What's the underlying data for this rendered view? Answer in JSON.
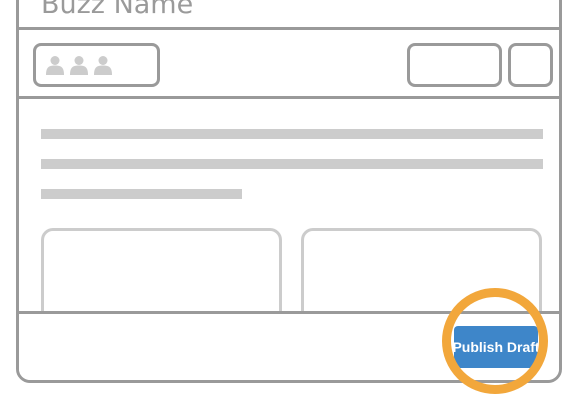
{
  "card": {
    "title": "Buzz Name",
    "members_icons": [
      "person-icon",
      "person-icon",
      "person-icon"
    ]
  },
  "footer": {
    "publish_label": "Publish Draft"
  },
  "colors": {
    "border": "#9a9a9a",
    "placeholder": "#cccccc",
    "button": "#3e86c9",
    "highlight": "#f2a73b"
  }
}
